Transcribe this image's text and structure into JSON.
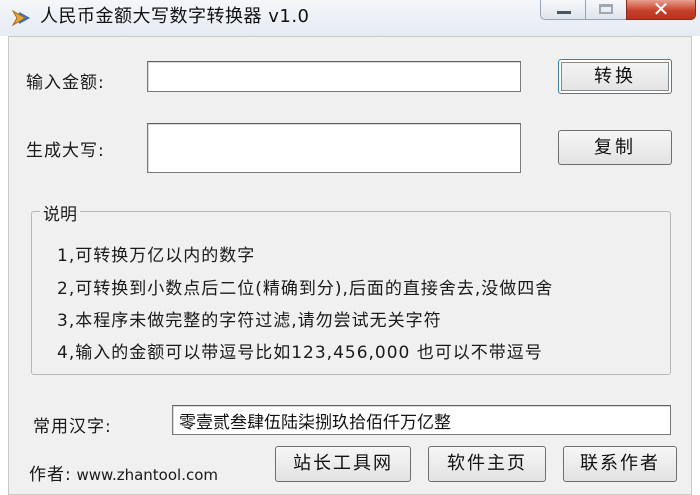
{
  "window": {
    "title": "人民币金额大写数字转换器 v1.0",
    "icon": "app-arrow-icon",
    "controls": [
      "minimize-icon",
      "maximize-icon",
      "close-icon"
    ],
    "close_glyph": "✕"
  },
  "form": {
    "input_label": "输入金额:",
    "input_value": "",
    "output_label": "生成大写:",
    "output_value": "",
    "convert_button": "转换",
    "copy_button": "复制"
  },
  "notes": {
    "title": "说明",
    "items": [
      "1,可转换万亿以内的数字",
      "2,可转换到小数点后二位(精确到分),后面的直接舍去,没做四舍",
      "3,本程序未做完整的字符过滤,请勿尝试无关字符",
      "4,输入的金额可以带逗号比如123,456,000 也可以不带逗号"
    ]
  },
  "common_chars": {
    "label": "常用汉字:",
    "value": "零壹贰叁肆伍陆柒捌玖拾佰仟万亿整"
  },
  "footer": {
    "author_label": "作者:",
    "author_site": "www.zhantool.com",
    "buttons": [
      "站长工具网",
      "软件主页",
      "联系作者"
    ]
  },
  "colors": {
    "window_bg": "#f0f0f0",
    "close_button": "#c7422a",
    "field_bg": "#ffffff"
  }
}
